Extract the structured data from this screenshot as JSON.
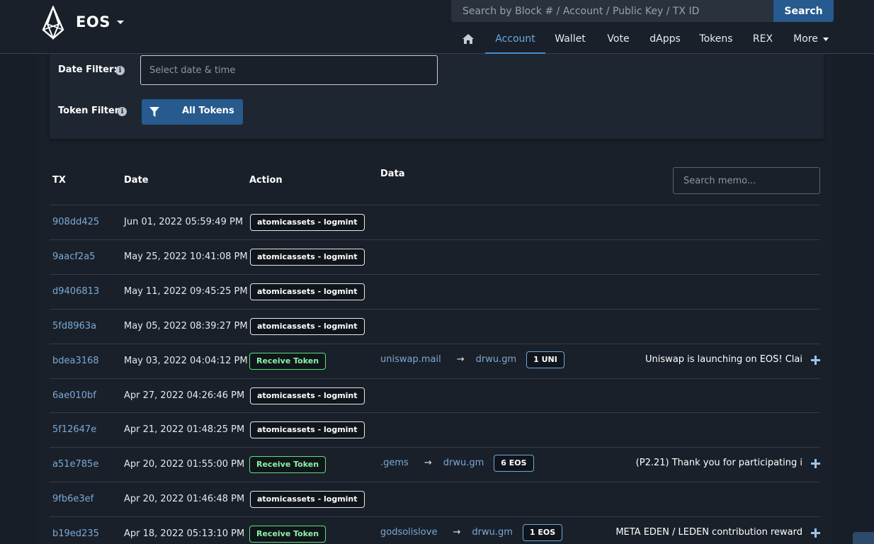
{
  "brand": {
    "name": "EOS"
  },
  "search": {
    "placeholder": "Search by Block # / Account / Public Key / TX ID",
    "button": "Search"
  },
  "nav": {
    "items": [
      {
        "label": "Account",
        "active": true
      },
      {
        "label": "Wallet"
      },
      {
        "label": "Vote"
      },
      {
        "label": "dApps"
      },
      {
        "label": "Tokens"
      },
      {
        "label": "REX"
      },
      {
        "label": "More"
      }
    ]
  },
  "filters": {
    "date_label": "Date Filter:",
    "date_placeholder": "Select date & time",
    "token_label": "Token Filter:",
    "token_button": "All Tokens"
  },
  "table": {
    "headers": {
      "tx": "TX",
      "date": "Date",
      "action": "Action",
      "data": "Data"
    },
    "memo_placeholder": "Search memo...",
    "rows": [
      {
        "tx": "908dd425",
        "date": "Jun 01, 2022 05:59:49 PM",
        "action": "atomicassets - logmint"
      },
      {
        "tx": "9aacf2a5",
        "date": "May 25, 2022 10:41:08 PM",
        "action": "atomicassets - logmint"
      },
      {
        "tx": "d9406813",
        "date": "May 11, 2022 09:45:25 PM",
        "action": "atomicassets - logmint"
      },
      {
        "tx": "5fd8963a",
        "date": "May 05, 2022 08:39:27 PM",
        "action": "atomicassets - logmint"
      },
      {
        "tx": "bdea3168",
        "date": "May 03, 2022 04:04:12 PM",
        "action": "Receive Token",
        "from": "uniswap.mail",
        "to": "drwu.gm",
        "amount": "1 UNI",
        "memo": "Uniswap is launching on EOS! Clai"
      },
      {
        "tx": "6ae010bf",
        "date": "Apr 27, 2022 04:26:46 PM",
        "action": "atomicassets - logmint"
      },
      {
        "tx": "5f12647e",
        "date": "Apr 21, 2022 01:48:25 PM",
        "action": "atomicassets - logmint"
      },
      {
        "tx": "a51e785e",
        "date": "Apr 20, 2022 01:55:00 PM",
        "action": "Receive Token",
        "from": ".gems",
        "to": "drwu.gm",
        "amount": "6 EOS",
        "memo": "(P2.21) Thank you for participating i"
      },
      {
        "tx": "9fb6e3ef",
        "date": "Apr 20, 2022 01:46:48 PM",
        "action": "atomicassets - logmint"
      },
      {
        "tx": "b19ed235",
        "date": "Apr 18, 2022 05:13:10 PM",
        "action": "Receive Token",
        "from": "godsolislove",
        "to": "drwu.gm",
        "amount": "1 EOS",
        "memo": "META EDEN / LEDEN contribution reward"
      }
    ]
  },
  "icons": {
    "logo": "eos-logo-icon",
    "home": "home-icon",
    "info": "info-icon",
    "filter": "filter-icon",
    "arrow": "→",
    "plus": "plus-icon"
  },
  "colors": {
    "background": "#181e27",
    "accent": "#275a8e",
    "link": "#7aa9d6",
    "receive_badge": "#5fe07a"
  }
}
